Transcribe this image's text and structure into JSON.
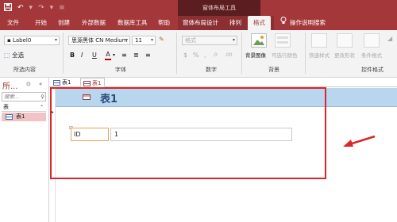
{
  "title_bar": {
    "context_title": "窗体布局工具",
    "qat_icons": [
      "save-icon",
      "undo-icon",
      "redo-icon"
    ]
  },
  "tabs": {
    "items": [
      "文件",
      "开始",
      "创建",
      "外部数据",
      "数据库工具",
      "帮助",
      "窗体布局设计",
      "排列",
      "格式"
    ],
    "active": "格式",
    "tell_me": "操作说明搜索"
  },
  "ribbon": {
    "selection_group": {
      "object_select": "Label0",
      "select_all": "全选",
      "label": "所选内容"
    },
    "font_group": {
      "font_name": "思源黑体 CN Medium",
      "font_size": "11",
      "bold": "B",
      "italic": "I",
      "underline": "U",
      "font_color_glyph": "A",
      "label": "字体"
    },
    "number_group": {
      "format_select": "格式",
      "label": "数字"
    },
    "background_group": {
      "bg_image": "背景图像",
      "alt_row_color": "可选行颜色",
      "label": "背景"
    },
    "control_format_group": {
      "quick_styles": "快速样式",
      "change_shape": "更改形状",
      "conditional_format": "条件格式",
      "label": "控件格式"
    }
  },
  "nav_pane": {
    "title": "所...",
    "search_placeholder": "搜索...",
    "section": "表",
    "items": [
      "表1"
    ]
  },
  "document": {
    "tabs": [
      "表1",
      "表1"
    ],
    "active_tab_index": 1,
    "form_title": "表1",
    "field_label": "ID",
    "field_value": "1"
  },
  "colors": {
    "accent": "#a4373a",
    "header_band": "#b8d6ee",
    "annotation": "#d9262a"
  }
}
